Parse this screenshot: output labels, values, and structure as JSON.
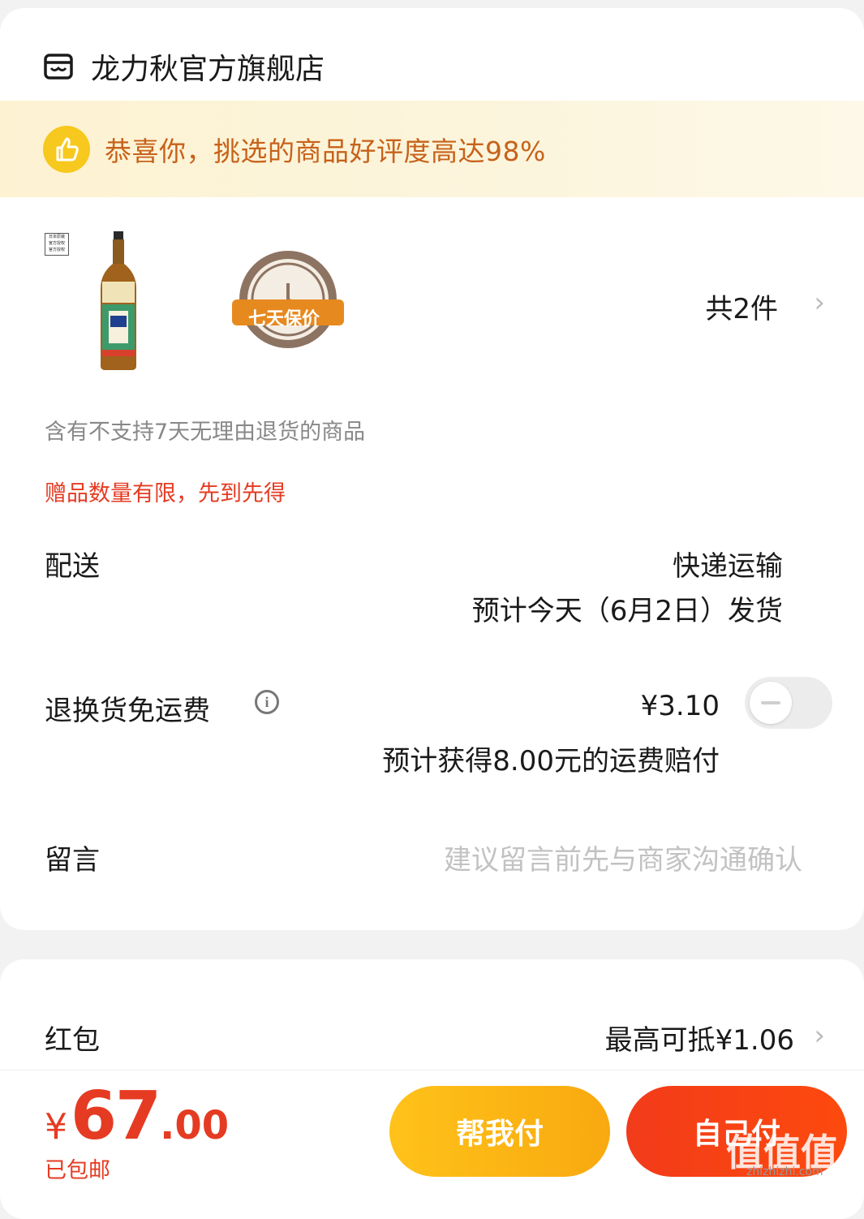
{
  "store": {
    "name": "龙力秋官方旗舰店",
    "icon": "store-icon"
  },
  "banner": {
    "text": "恭喜你，挑选的商品好评度高达98%",
    "icon": "thumbs-up-icon"
  },
  "product": {
    "badge_lines": [
      "日本原装",
      "官方授权",
      "官方授权"
    ],
    "seal_text": "七天保价",
    "count_label": "共2件"
  },
  "notes": {
    "return_policy": "含有不支持7天无理由退货的商品",
    "gift_limit": "赠品数量有限，先到先得"
  },
  "delivery": {
    "label": "配送",
    "method": "快递运输",
    "eta": "预计今天（6月2日）发货"
  },
  "return_shipping": {
    "label": "退换货免运费",
    "price": "¥3.10",
    "compensation": "预计获得8.00元的运费赔付",
    "enabled": false
  },
  "message": {
    "label": "留言",
    "placeholder": "建议留言前先与商家沟通确认"
  },
  "red_packet": {
    "label": "红包",
    "value": "最高可抵¥1.06"
  },
  "footer": {
    "currency": "¥",
    "price_int": "67",
    "price_dec": ".00",
    "shipping": "已包邮",
    "help_pay_label": "帮我付",
    "self_pay_label": "自己付"
  },
  "watermark": {
    "text": "值值值",
    "sub": "zhizhizhi.com"
  },
  "colors": {
    "accent_red": "#e53b22",
    "banner_text": "#c7621a",
    "help_btn": "#ffc21a",
    "self_btn": "#f23b1a"
  }
}
